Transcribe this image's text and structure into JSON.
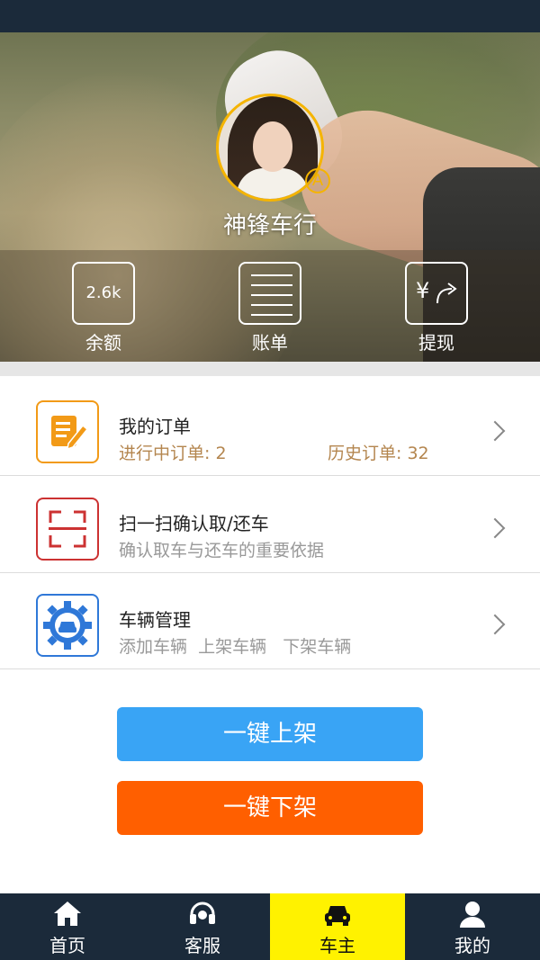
{
  "profile": {
    "store_name": "神锋车行",
    "badge": "A"
  },
  "stats": {
    "balance": {
      "value": "2.6k",
      "label": "余额"
    },
    "bill": {
      "label": "账单"
    },
    "withdraw": {
      "icon_text": "¥",
      "label": "提现"
    }
  },
  "menu": {
    "orders": {
      "title": "我的订单",
      "in_progress": "进行中订单: 2",
      "history": "历史订单: 32"
    },
    "scan": {
      "title": "扫一扫确认取/还车",
      "subtitle": "确认取车与还车的重要依据"
    },
    "vehicles": {
      "title": "车辆管理",
      "subtitle": "添加车辆  上架车辆   下架车辆"
    }
  },
  "actions": {
    "list_all": "一键上架",
    "unlist_all": "一键下架"
  },
  "tabbar": [
    {
      "label": "首页",
      "icon": "home-icon"
    },
    {
      "label": "客服",
      "icon": "headset-icon"
    },
    {
      "label": "车主",
      "icon": "car-icon",
      "active": true
    },
    {
      "label": "我的",
      "icon": "user-icon"
    }
  ],
  "colors": {
    "accent_blue": "#39a4f5",
    "accent_orange": "#ff5f00",
    "active_tab": "#fff200",
    "bar_bg": "#1b2a3a"
  }
}
